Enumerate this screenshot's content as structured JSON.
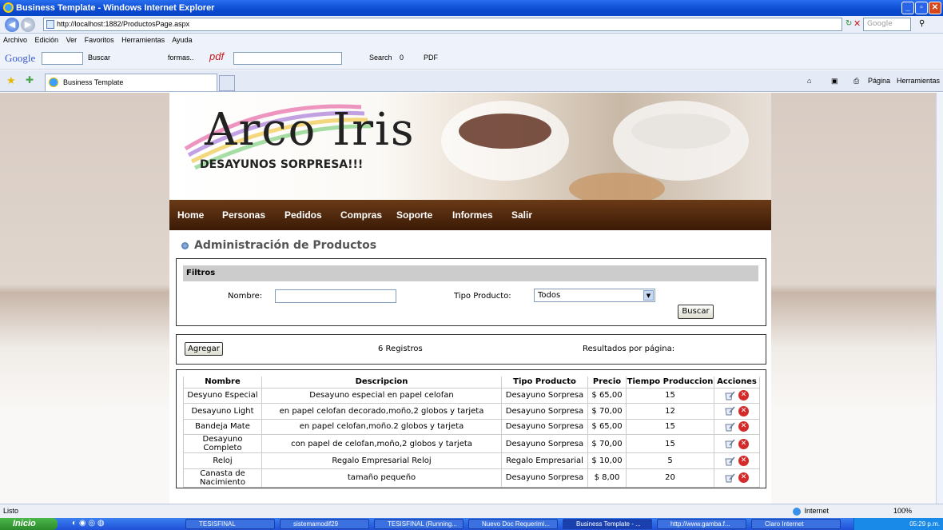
{
  "window": {
    "title": "Business Template - Windows Internet Explorer"
  },
  "address": {
    "url": "http://localhost:1882/ProductosPage.aspx",
    "search_placeholder": "Google"
  },
  "menu": [
    "Archivo",
    "Edición",
    "Ver",
    "Favoritos",
    "Herramientas",
    "Ayuda"
  ],
  "google_toolbar": {
    "brand": "Google",
    "buscar": "Buscar",
    "formas": "formas..",
    "pdf": "pdf",
    "search": "Search",
    "count": "0",
    "pdf2": "PDF"
  },
  "tab": {
    "title": "Business Template"
  },
  "ie_tools": {
    "pagina": "Página",
    "herramientas": "Herramientas"
  },
  "banner": {
    "logo": "Arco Iris",
    "slogan": "DESAYUNOS SORPRESA!!!"
  },
  "nav": [
    "Home",
    "Personas",
    "Pedidos",
    "Compras",
    "Soporte",
    "Informes",
    "Salir"
  ],
  "heading": "Administración de Productos",
  "filters": {
    "title": "Filtros",
    "nombre_label": "Nombre:",
    "nombre_value": "",
    "tipo_label": "Tipo Producto:",
    "tipo_value": "Todos",
    "buscar": "Buscar"
  },
  "toolbar": {
    "agregar": "Agregar",
    "registros": "6 Registros",
    "resultados": "Resultados por página:"
  },
  "table": {
    "headers": [
      "Nombre",
      "Descripcion",
      "Tipo Producto",
      "Precio",
      "Tiempo Produccion",
      "Acciones"
    ],
    "rows": [
      [
        "Desyuno Especial",
        "Desayuno especial en papel celofan",
        "Desayuno Sorpresa",
        "$ 65,00",
        "15"
      ],
      [
        "Desayuno Light",
        "en papel celofan decorado,moño,2 globos y tarjeta",
        "Desayuno Sorpresa",
        "$ 70,00",
        "12"
      ],
      [
        "Bandeja Mate",
        "en papel celofan,moño.2 globos y tarjeta",
        "Desayuno Sorpresa",
        "$ 65,00",
        "15"
      ],
      [
        "Desayuno Completo",
        "con papel de celofan,moño,2 globos y tarjeta",
        "Desayuno Sorpresa",
        "$ 70,00",
        "15"
      ],
      [
        "Reloj",
        "Regalo Empresarial Reloj",
        "Regalo Empresarial",
        "$ 10,00",
        "5"
      ],
      [
        "Canasta de Nacimiento",
        "tamaño pequeño",
        "Desayuno Sorpresa",
        "$ 8,00",
        "20"
      ]
    ]
  },
  "status": {
    "left": "Listo",
    "zone": "Internet",
    "zoom": "100%"
  },
  "taskbar": {
    "start": "Inicio",
    "tasks": [
      "TESISFINAL",
      "sistemamodif29",
      "TESISFINAL (Running...",
      "Nuevo Doc Requerimi...",
      "Business Template - ...",
      "http://www.gamba.f...",
      "Claro Internet"
    ],
    "clock": "05:29 p.m."
  },
  "colors": {
    "nav_bg": "#4a2308",
    "titlebar": "#0a4ad0",
    "delete": "#d42a2a"
  }
}
